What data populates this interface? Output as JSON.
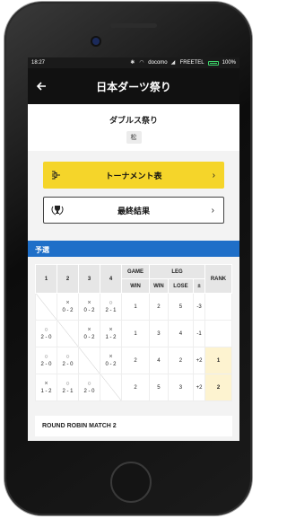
{
  "status_bar": {
    "time": "18:27",
    "carrier1": "docomo",
    "carrier2": "FREETEL",
    "battery": "100%",
    "battery_color": "#3cd66a"
  },
  "app_bar": {
    "title": "日本ダーツ祭り",
    "back_icon": "arrow-left-icon"
  },
  "event": {
    "name": "ダブルス祭り",
    "badge": "松"
  },
  "buttons": {
    "tournament": {
      "label": "トーナメント表",
      "icon": "bracket-icon",
      "bg": "#f5d52a"
    },
    "final_results": {
      "label": "最終結果",
      "icon": "laurel-trophy-icon",
      "bg": "#ffffff"
    }
  },
  "section": {
    "title": "予選",
    "color": "#1f6fc8"
  },
  "table": {
    "headers": {
      "cols": [
        "1",
        "2",
        "3",
        "4"
      ],
      "game": "GAME",
      "leg": "LEG",
      "rank": "RANK",
      "win": "WIN",
      "leg_win": "WIN",
      "leg_lose": "LOSE",
      "diff": "±"
    },
    "rows": [
      {
        "cells": [
          {
            "type": "diag"
          },
          {
            "mark": "×",
            "score": "0 - 2"
          },
          {
            "mark": "×",
            "score": "0 - 2"
          },
          {
            "mark": "○",
            "score": "2 - 1"
          }
        ],
        "game_win": "1",
        "leg_win": "2",
        "leg_lose": "5",
        "diff": "-3",
        "rank": ""
      },
      {
        "cells": [
          {
            "mark": "○",
            "score": "2 - 0"
          },
          {
            "type": "diag"
          },
          {
            "mark": "×",
            "score": "0 - 2"
          },
          {
            "mark": "×",
            "score": "1 - 2"
          }
        ],
        "game_win": "1",
        "leg_win": "3",
        "leg_lose": "4",
        "diff": "-1",
        "rank": ""
      },
      {
        "cells": [
          {
            "mark": "○",
            "score": "2 - 0"
          },
          {
            "mark": "○",
            "score": "2 - 0"
          },
          {
            "type": "diag"
          },
          {
            "mark": "×",
            "score": "0 - 2"
          }
        ],
        "game_win": "2",
        "leg_win": "4",
        "leg_lose": "2",
        "diff": "+2",
        "rank": "1"
      },
      {
        "cells": [
          {
            "mark": "×",
            "score": "1 - 2"
          },
          {
            "mark": "○",
            "score": "2 - 1"
          },
          {
            "mark": "○",
            "score": "2 - 0"
          },
          {
            "type": "diag"
          }
        ],
        "game_win": "2",
        "leg_win": "5",
        "leg_lose": "3",
        "diff": "+2",
        "rank": "2"
      }
    ]
  },
  "next_card": {
    "title": "ROUND ROBIN MATCH 2"
  }
}
